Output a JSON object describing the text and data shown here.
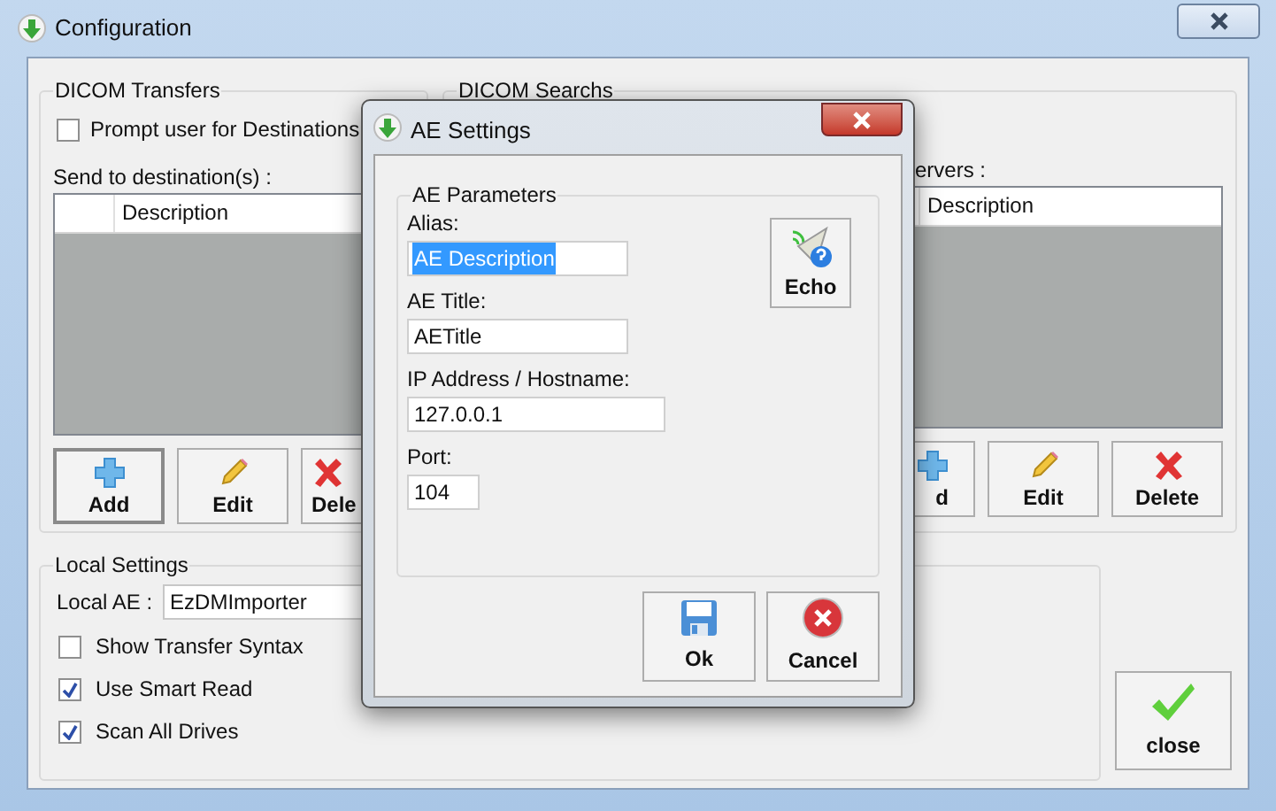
{
  "window": {
    "title": "Configuration"
  },
  "dicom_transfers": {
    "title": "DICOM Transfers",
    "prompt": {
      "label": "Prompt user for Destinations",
      "checked": false
    },
    "list_label": "Send to destination(s) :",
    "columns": [
      "Description"
    ],
    "buttons": [
      {
        "label": "Add",
        "kind": "add",
        "focused": true
      },
      {
        "label": "Edit",
        "kind": "edit",
        "focused": false
      },
      {
        "label": "Dele",
        "kind": "delete",
        "focused": false
      }
    ]
  },
  "dicom_searches": {
    "title": "DICOM Searchs",
    "list_label": "ervers :",
    "columns": [
      "Description"
    ],
    "buttons": [
      {
        "label": "d",
        "kind": "add",
        "focused": false
      },
      {
        "label": "Edit",
        "kind": "edit",
        "focused": false
      },
      {
        "label": "Delete",
        "kind": "delete",
        "focused": false
      }
    ]
  },
  "local_settings": {
    "title": "Local Settings",
    "local_ae": {
      "label": "Local AE :",
      "value": "EzDMImporter"
    },
    "options": [
      {
        "label": "Show Transfer Syntax",
        "checked": false
      },
      {
        "label": "Use Smart Read",
        "checked": true
      },
      {
        "label": "Scan All Drives",
        "checked": true
      }
    ]
  },
  "close_button": {
    "label": "close"
  },
  "dialog": {
    "title": "AE Settings",
    "group_title": "AE Parameters",
    "fields": [
      {
        "label": "Alias:",
        "value": "AE Description",
        "selected": true
      },
      {
        "label": "AE Title:",
        "value": "AETitle",
        "selected": false
      },
      {
        "label": "IP Address / Hostname:",
        "value": "127.0.0.1",
        "selected": false
      },
      {
        "label": "Port:",
        "value": "104",
        "selected": false
      }
    ],
    "echo_button": {
      "label": "Echo"
    },
    "buttons": [
      {
        "label": "Ok",
        "kind": "save"
      },
      {
        "label": "Cancel",
        "kind": "cancel"
      }
    ]
  }
}
